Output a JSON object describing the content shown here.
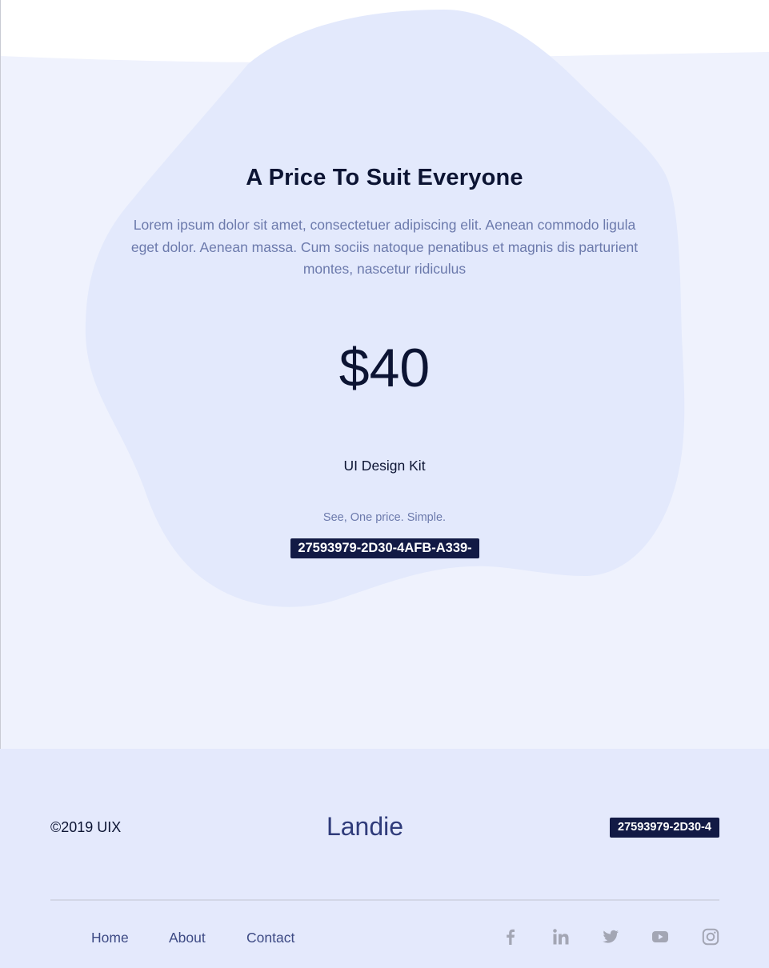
{
  "pricing": {
    "title": "A Price To Suit Everyone",
    "description": "Lorem ipsum dolor sit amet, consectetuer adipiscing elit. Aenean commodo ligula eget dolor. Aenean massa. Cum sociis natoque penatibus et magnis dis parturient montes, nascetur ridiculus",
    "price": "$40",
    "product": "UI Design Kit",
    "tagline": "See, One price. Simple.",
    "button_label": "27593979-2D30-4AFB-A339-"
  },
  "footer": {
    "copyright": "©2019 UIX",
    "brand": "Landie",
    "button_label": "27593979-2D30-4",
    "nav": [
      {
        "label": "Home"
      },
      {
        "label": "About"
      },
      {
        "label": "Contact"
      }
    ],
    "social_icons": [
      "facebook-icon",
      "linkedin-icon",
      "twitter-icon",
      "youtube-icon",
      "instagram-icon"
    ]
  },
  "colors": {
    "heading": "#0c1433",
    "muted_text": "#6c7aac",
    "section_bg": "#eff2fd",
    "blob": "#e3e9fc",
    "badge_bg": "#121a45",
    "footer_bg": "#e4e9fc",
    "brand": "#2f3b7a",
    "icon": "#a3a6b4"
  }
}
